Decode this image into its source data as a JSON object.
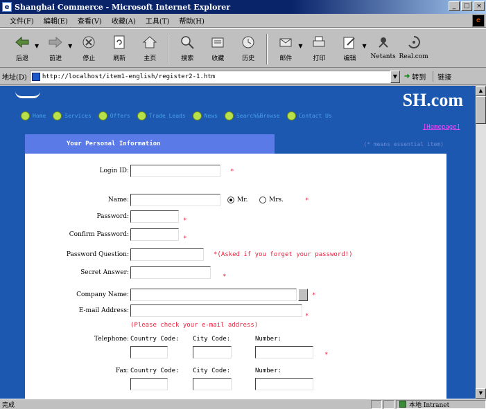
{
  "window": {
    "title": "Shanghai Commerce - Microsoft Internet Explorer",
    "controls": [
      "_",
      "□",
      "×"
    ]
  },
  "menubar": {
    "items": [
      "文件(F)",
      "編輯(E)",
      "查看(V)",
      "收藏(A)",
      "工具(T)",
      "帮助(H)"
    ]
  },
  "toolbar": {
    "buttons": [
      {
        "label": "后退",
        "icon": "back-arrow-icon"
      },
      {
        "label": "前进",
        "icon": "forward-arrow-icon"
      },
      {
        "label": "停止",
        "icon": "stop-icon"
      },
      {
        "label": "刷新",
        "icon": "refresh-icon"
      },
      {
        "label": "主页",
        "icon": "home-icon"
      },
      {
        "label": "搜索",
        "icon": "search-icon"
      },
      {
        "label": "收藏",
        "icon": "favorites-icon"
      },
      {
        "label": "历史",
        "icon": "history-icon"
      },
      {
        "label": "邮件",
        "icon": "mail-icon"
      },
      {
        "label": "打印",
        "icon": "print-icon"
      },
      {
        "label": "编辑",
        "icon": "edit-icon"
      },
      {
        "label": "Netants",
        "icon": "netants-icon"
      },
      {
        "label": "Real.com",
        "icon": "real-icon"
      }
    ]
  },
  "address": {
    "label": "地址(D)",
    "url": "http://localhost/item1-english/register2-1.htm",
    "go_label": "转到",
    "links_label": "链接"
  },
  "site": {
    "logo": "SH.com",
    "nav": [
      "Home",
      "Services",
      "Offers",
      "Trade Leads",
      "News",
      "Search&Browse",
      "Contact Us"
    ],
    "homepage_link": "[Homepage]"
  },
  "form": {
    "section_title": "Your Personal Information",
    "essential_note": "(* means essential item)",
    "required_mark": "*",
    "fields": {
      "login_id": {
        "label": "Login ID:"
      },
      "name": {
        "label": "Name:",
        "mr": "Mr.",
        "mrs": "Mrs."
      },
      "password": {
        "label": "Password:"
      },
      "confirm_password": {
        "label": "Confirm Password:"
      },
      "password_question": {
        "label": "Password Question:",
        "note": "*(Asked if you forget your password!)"
      },
      "secret_answer": {
        "label": "Secret Answer:"
      },
      "company_name": {
        "label": "Company Name:"
      },
      "email": {
        "label": "E-mail Address:",
        "note": "(Please check your e-mail address)"
      },
      "telephone": {
        "label": "Telephone:"
      },
      "fax": {
        "label": "Fax:"
      }
    },
    "phone_parts": {
      "country_code": "Country Code:",
      "city_code": "City Code:",
      "number": "Number:"
    }
  },
  "statusbar": {
    "status": "完成",
    "zone": "本地 Intranet"
  },
  "colors": {
    "page_bg": "#1c58b0",
    "header_band": "#5a7ae8",
    "required": "#e8203c",
    "nav_link": "#4aa0e8",
    "homepage_link": "#ff44ff"
  }
}
